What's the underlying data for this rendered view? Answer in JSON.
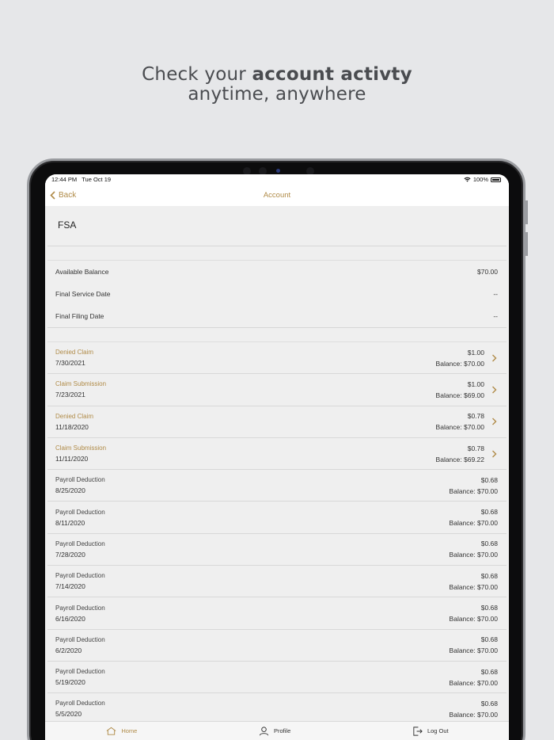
{
  "headline": {
    "line1_normal": "Check your ",
    "line1_bold": "account activty",
    "line2": "anytime, anywhere"
  },
  "status_bar": {
    "time": "12:44 PM",
    "date": "Tue Oct 19",
    "battery": "100%"
  },
  "nav": {
    "back_label": "Back",
    "title": "Account"
  },
  "account": {
    "name": "FSA"
  },
  "info": [
    {
      "label": "Available Balance",
      "value": "$70.00"
    },
    {
      "label": "Final Service Date",
      "value": "--"
    },
    {
      "label": "Final Filing Date",
      "value": "--"
    }
  ],
  "transactions": [
    {
      "type": "Denied Claim",
      "date": "7/30/2021",
      "amount": "$1.00",
      "balance": "Balance: $70.00"
    },
    {
      "type": "Claim Submission",
      "date": "7/23/2021",
      "amount": "$1.00",
      "balance": "Balance: $69.00"
    },
    {
      "type": "Denied Claim",
      "date": "11/18/2020",
      "amount": "$0.78",
      "balance": "Balance: $70.00"
    },
    {
      "type": "Claim Submission",
      "date": "11/11/2020",
      "amount": "$0.78",
      "balance": "Balance: $69.22"
    },
    {
      "type": "Payroll Deduction",
      "date": "8/25/2020",
      "amount": "$0.68",
      "balance": "Balance: $70.00"
    },
    {
      "type": "Payroll Deduction",
      "date": "8/11/2020",
      "amount": "$0.68",
      "balance": "Balance: $70.00"
    },
    {
      "type": "Payroll Deduction",
      "date": "7/28/2020",
      "amount": "$0.68",
      "balance": "Balance: $70.00"
    },
    {
      "type": "Payroll Deduction",
      "date": "7/14/2020",
      "amount": "$0.68",
      "balance": "Balance: $70.00"
    },
    {
      "type": "Payroll Deduction",
      "date": "6/16/2020",
      "amount": "$0.68",
      "balance": "Balance: $70.00"
    },
    {
      "type": "Payroll Deduction",
      "date": "6/2/2020",
      "amount": "$0.68",
      "balance": "Balance: $70.00"
    },
    {
      "type": "Payroll Deduction",
      "date": "5/19/2020",
      "amount": "$0.68",
      "balance": "Balance: $70.00"
    },
    {
      "type": "Payroll Deduction",
      "date": "5/5/2020",
      "amount": "$0.68",
      "balance": "Balance: $70.00"
    }
  ],
  "tabs": [
    {
      "label": "Home",
      "icon": "home-icon",
      "active": true
    },
    {
      "label": "Profile",
      "icon": "profile-icon",
      "active": false
    },
    {
      "label": "Log Out",
      "icon": "logout-icon",
      "active": false
    }
  ],
  "colors": {
    "accent": "#b08b48",
    "background": "#e6e7e9",
    "screen": "#efefef"
  }
}
